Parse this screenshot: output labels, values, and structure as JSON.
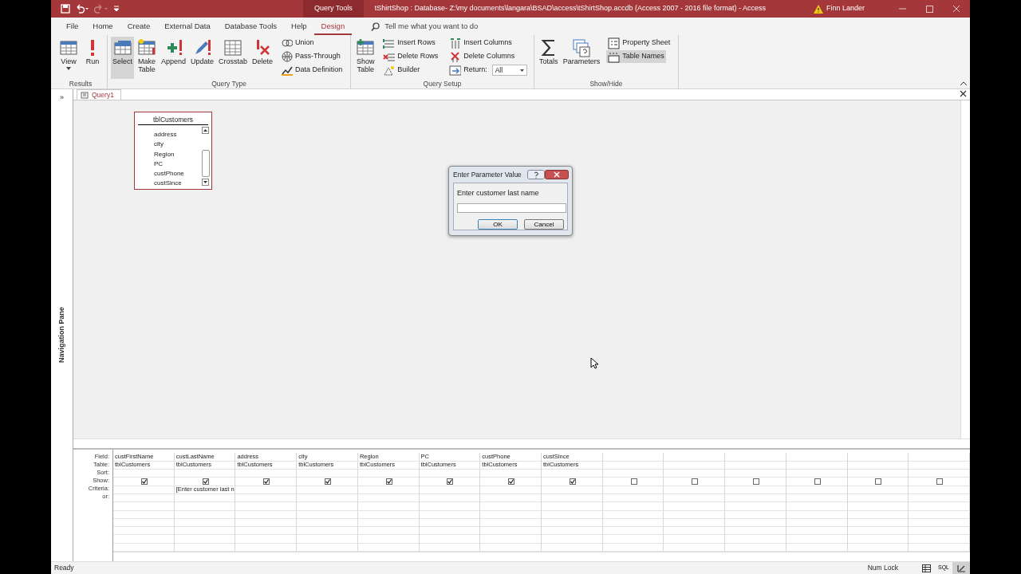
{
  "title_bar": {
    "context_tab": "Query Tools",
    "title": "tShirtShop : Database- Z:\\my documents\\langara\\BSAD\\access\\tShirtShop.accdb (Access 2007 - 2016 file format)  -  Access",
    "user": "Finn Lander",
    "redo_disabled": true
  },
  "ribbon_tabs": [
    {
      "label": "File",
      "selected": false
    },
    {
      "label": "Home",
      "selected": false
    },
    {
      "label": "Create",
      "selected": false
    },
    {
      "label": "External Data",
      "selected": false
    },
    {
      "label": "Database Tools",
      "selected": false
    },
    {
      "label": "Help",
      "selected": false
    },
    {
      "label": "Design",
      "selected": true
    }
  ],
  "tell_me": "Tell me what you want to do",
  "ribbon_groups": [
    {
      "label": "Results",
      "items": [
        {
          "kind": "large",
          "label": "View",
          "dropdown": true,
          "selected": false
        },
        {
          "kind": "large",
          "label": "Run",
          "selected": false
        }
      ]
    },
    {
      "label": "Query Type",
      "items": [
        {
          "kind": "large",
          "label": "Select",
          "selected": true
        },
        {
          "kind": "large",
          "label": "Make Table",
          "selected": false
        },
        {
          "kind": "large",
          "label": "Append",
          "selected": false
        },
        {
          "kind": "large",
          "label": "Update",
          "selected": false
        },
        {
          "kind": "large",
          "label": "Crosstab",
          "selected": false
        },
        {
          "kind": "large",
          "label": "Delete",
          "selected": false
        },
        {
          "kind": "stack",
          "items": [
            {
              "label": "Union",
              "selected": false
            },
            {
              "label": "Pass-Through",
              "selected": false
            },
            {
              "label": "Data Definition",
              "selected": false
            }
          ]
        }
      ]
    },
    {
      "label": "Query Setup",
      "items": [
        {
          "kind": "large",
          "label": "Show Table",
          "selected": false
        },
        {
          "kind": "stack",
          "items": [
            {
              "label": "Insert Rows",
              "selected": false
            },
            {
              "label": "Delete Rows",
              "selected": false
            },
            {
              "label": "Builder",
              "selected": false
            }
          ]
        },
        {
          "kind": "stack",
          "items": [
            {
              "label": "Insert Columns",
              "selected": false
            },
            {
              "label": "Delete Columns",
              "selected": false
            },
            {
              "label": "Return:",
              "selected": false,
              "combo": "All"
            }
          ]
        }
      ]
    },
    {
      "label": "Show/Hide",
      "items": [
        {
          "kind": "large",
          "label": "Totals",
          "selected": false
        },
        {
          "kind": "large",
          "label": "Parameters",
          "selected": false
        },
        {
          "kind": "stack",
          "items": [
            {
              "label": "Property Sheet",
              "selected": false
            },
            {
              "label": "Table Names",
              "selected": true
            }
          ]
        }
      ]
    }
  ],
  "navigation_pane": {
    "expand": "»",
    "label": "Navigation Pane"
  },
  "document_tabs": [
    {
      "label": "Query1",
      "selected": true
    }
  ],
  "table_box": {
    "title": "tblCustomers",
    "fields": [
      "address",
      "city",
      "Region",
      "PC",
      "custPhone",
      "custSince"
    ]
  },
  "dialog": {
    "title": "Enter Parameter Value",
    "prompt": "Enter customer last name",
    "ok": "OK",
    "cancel": "Cancel"
  },
  "grid": {
    "row_labels": [
      "Field:",
      "Table:",
      "Sort:",
      "Show:",
      "Criteria:",
      "or:"
    ],
    "columns": [
      {
        "field": "custFirstName",
        "table": "tblCustomers",
        "show": true
      },
      {
        "field": "custLastName",
        "table": "tblCustomers",
        "show": true,
        "criteria": "[Enter customer last n"
      },
      {
        "field": "address",
        "table": "tblCustomers",
        "show": true
      },
      {
        "field": "city",
        "table": "tblCustomers",
        "show": true
      },
      {
        "field": "Region",
        "table": "tblCustomers",
        "show": true
      },
      {
        "field": "PC",
        "table": "tblCustomers",
        "show": true
      },
      {
        "field": "custPhone",
        "table": "tblCustomers",
        "show": true
      },
      {
        "field": "custSince",
        "table": "tblCustomers",
        "show": true
      },
      {
        "show": false
      },
      {
        "show": false
      },
      {
        "show": false
      },
      {
        "show": false
      },
      {
        "show": false
      },
      {
        "show": false
      }
    ]
  },
  "status_bar": {
    "status": "Ready",
    "indicators": [
      "Num Lock"
    ],
    "views": [
      {
        "kind": "datasheet",
        "selected": false
      },
      {
        "kind": "sql",
        "label": "SQL",
        "selected": false
      },
      {
        "kind": "design",
        "selected": true
      }
    ]
  }
}
